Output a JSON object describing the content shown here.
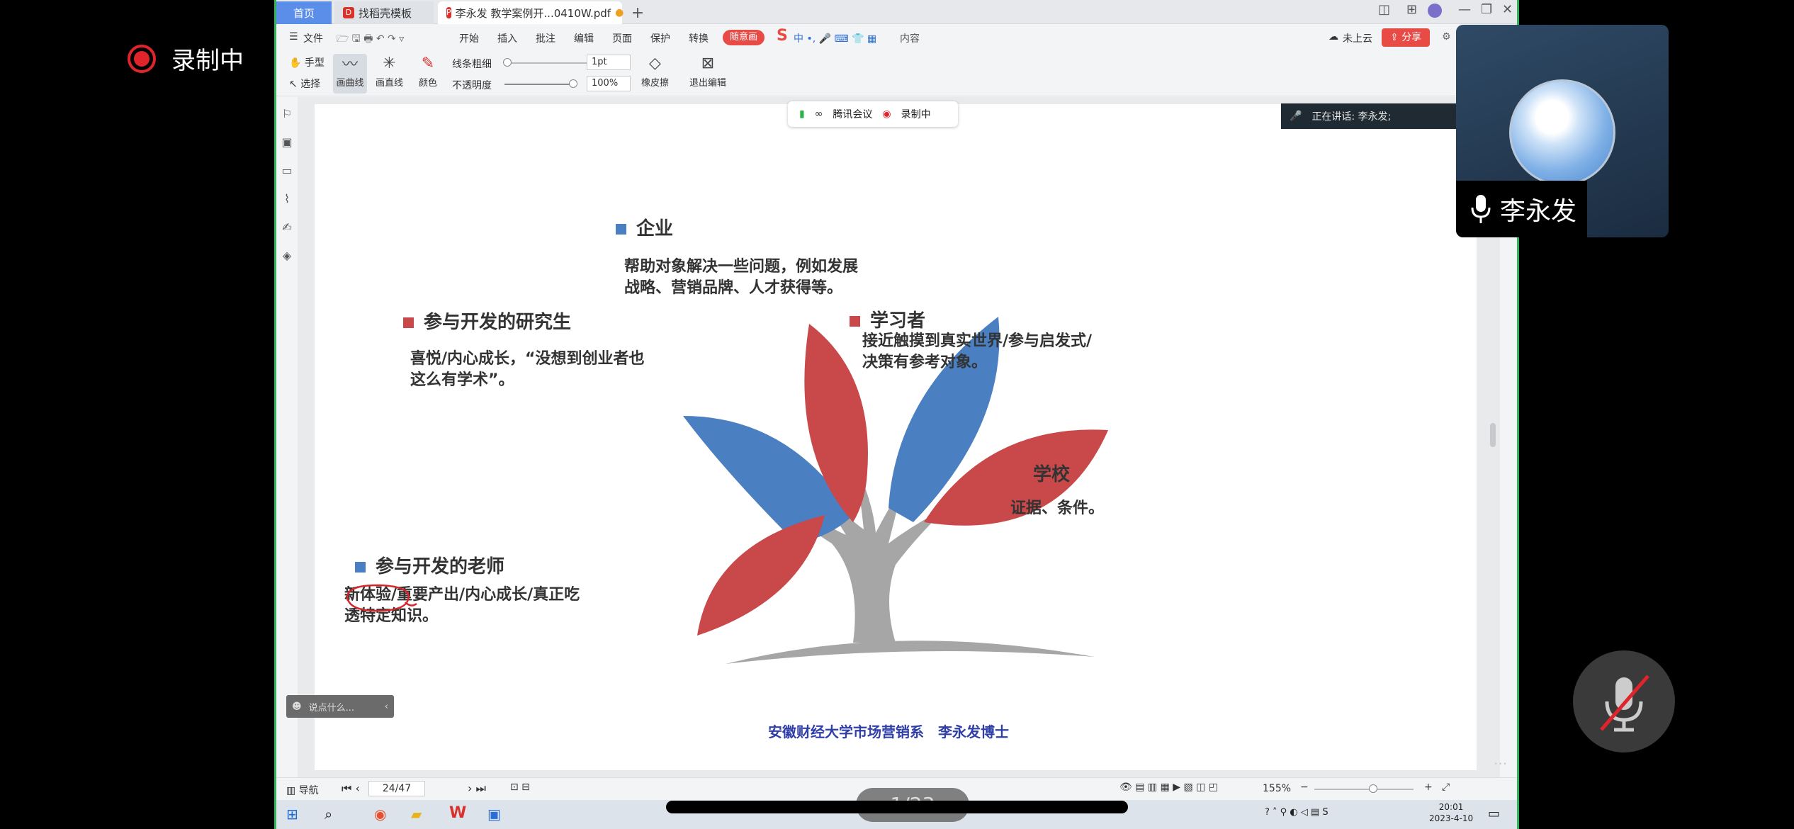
{
  "recording": {
    "label": "录制中"
  },
  "tabs": {
    "home": "首页",
    "template": "找稻壳模板",
    "document": "李永发 教学案例开...0410W.pdf"
  },
  "menu": {
    "file": "文件",
    "items": [
      "开始",
      "插入",
      "批注",
      "编辑",
      "页面",
      "保护",
      "转换"
    ],
    "random_pen": "随意画",
    "content": "内容",
    "cloud": "未上云",
    "share": "分享"
  },
  "toolbar": {
    "hand": "手型",
    "select": "选择",
    "curve": "画曲线",
    "straight": "画直线",
    "color": "颜色",
    "line_width_label": "线条粗细",
    "line_width_value": "1pt",
    "opacity_label": "不透明度",
    "opacity_value": "100%",
    "eraser": "橡皮擦",
    "exit": "退出编辑"
  },
  "meeting": {
    "app": "腾讯会议",
    "recording": "录制中",
    "speaking": "正在讲话: 李永发;"
  },
  "slide": {
    "enterprise": {
      "title": "企业",
      "text": [
        "帮助对象解决一些问题，例如发展",
        "战略、营销品牌、人才获得等。"
      ]
    },
    "students": {
      "title": "参与开发的研究生",
      "text": [
        "喜悦/内心成长，“没想到创业者也",
        "这么有学术”。"
      ]
    },
    "learners": {
      "title": "学习者",
      "text": [
        "接近触摸到真实世界/参与启发式/",
        "决策有参考对象。"
      ]
    },
    "school": {
      "title": "学校",
      "text": [
        "证据、条件。"
      ]
    },
    "teachers": {
      "title": "参与开发的老师",
      "text": [
        "新体验/重要产出/内心成长/真正吃",
        "透特定知识。"
      ]
    },
    "footer": "安徽财经大学市场营销系　李永发博士",
    "colors": {
      "blue": "#4a7fc1",
      "red": "#c9484a",
      "gray": "#a6a6a6"
    }
  },
  "chat": {
    "placeholder": "说点什么..."
  },
  "status": {
    "nav": "导航",
    "page": "24/47",
    "zoom": "155%"
  },
  "taskbar": {
    "time": "20:01",
    "date": "2023-4-10"
  },
  "participant": {
    "name": "李永发"
  },
  "page_indicator": "1/23"
}
